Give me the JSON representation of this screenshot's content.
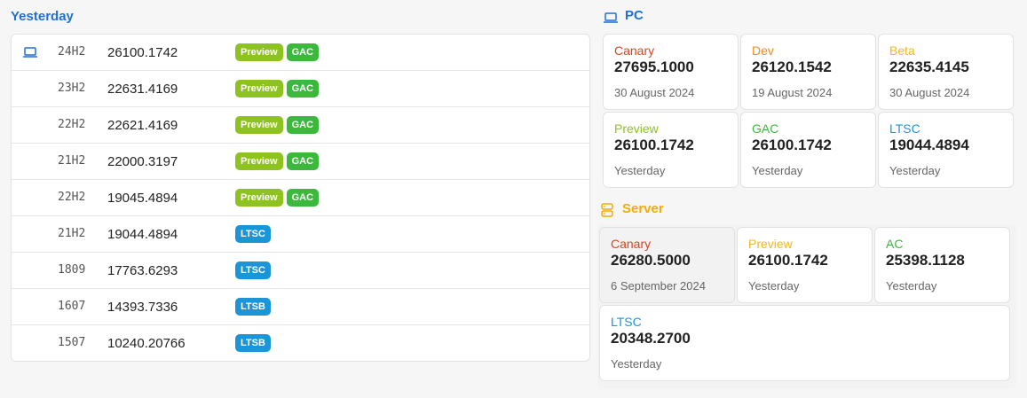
{
  "colors": {
    "accent_blue": "#1f6fd6",
    "server_title": "#f0ac0a",
    "canary": "#e0431b",
    "dev": "#f28d13",
    "beta": "#f2b81a",
    "preview": "#8dc21f",
    "gac": "#3cb93c",
    "ltsc": "#1a96d8",
    "ac": "#3cb93c"
  },
  "left": {
    "title": "Yesterday",
    "rows": [
      {
        "icon": "laptop-icon",
        "version": "24H2",
        "build": "26100.1742",
        "badges": [
          {
            "text": "Preview",
            "kind": "preview"
          },
          {
            "text": "GAC",
            "kind": "gac"
          }
        ]
      },
      {
        "icon": "",
        "version": "23H2",
        "build": "22631.4169",
        "badges": [
          {
            "text": "Preview",
            "kind": "preview"
          },
          {
            "text": "GAC",
            "kind": "gac"
          }
        ]
      },
      {
        "icon": "",
        "version": "22H2",
        "build": "22621.4169",
        "badges": [
          {
            "text": "Preview",
            "kind": "preview"
          },
          {
            "text": "GAC",
            "kind": "gac"
          }
        ]
      },
      {
        "icon": "",
        "version": "21H2",
        "build": "22000.3197",
        "badges": [
          {
            "text": "Preview",
            "kind": "preview"
          },
          {
            "text": "GAC",
            "kind": "gac"
          }
        ]
      },
      {
        "icon": "",
        "version": "22H2",
        "build": "19045.4894",
        "badges": [
          {
            "text": "Preview",
            "kind": "preview"
          },
          {
            "text": "GAC",
            "kind": "gac"
          }
        ]
      },
      {
        "icon": "",
        "version": "21H2",
        "build": "19044.4894",
        "badges": [
          {
            "text": "LTSC",
            "kind": "ltsc"
          }
        ]
      },
      {
        "icon": "",
        "version": "1809",
        "build": "17763.6293",
        "badges": [
          {
            "text": "LTSC",
            "kind": "ltsc"
          }
        ]
      },
      {
        "icon": "",
        "version": "1607",
        "build": "14393.7336",
        "badges": [
          {
            "text": "LTSB",
            "kind": "ltsb"
          }
        ]
      },
      {
        "icon": "",
        "version": "1507",
        "build": "10240.20766",
        "badges": [
          {
            "text": "LTSB",
            "kind": "ltsb"
          }
        ]
      }
    ]
  },
  "pc": {
    "title": "PC",
    "icon": "laptop-icon",
    "cards": [
      {
        "label": "Canary",
        "build": "27695.1000",
        "date": "30 August 2024",
        "color": "#e0431b"
      },
      {
        "label": "Dev",
        "build": "26120.1542",
        "date": "19 August 2024",
        "color": "#f28d13"
      },
      {
        "label": "Beta",
        "build": "22635.4145",
        "date": "30 August 2024",
        "color": "#f2b81a"
      },
      {
        "label": "Preview",
        "build": "26100.1742",
        "date": "Yesterday",
        "color": "#8dc21f"
      },
      {
        "label": "GAC",
        "build": "26100.1742",
        "date": "Yesterday",
        "color": "#3cb93c"
      },
      {
        "label": "LTSC",
        "build": "19044.4894",
        "date": "Yesterday",
        "color": "#1a96d8"
      }
    ]
  },
  "server": {
    "title": "Server",
    "icon": "server-icon",
    "cards": [
      {
        "label": "Canary",
        "build": "26280.5000",
        "date": "6 September 2024",
        "color": "#e0431b"
      },
      {
        "label": "Preview",
        "build": "26100.1742",
        "date": "Yesterday",
        "color": "#f2b81a"
      },
      {
        "label": "AC",
        "build": "25398.1128",
        "date": "Yesterday",
        "color": "#3cb93c"
      },
      {
        "label": "LTSC",
        "build": "20348.2700",
        "date": "Yesterday",
        "color": "#1a96d8"
      }
    ]
  }
}
